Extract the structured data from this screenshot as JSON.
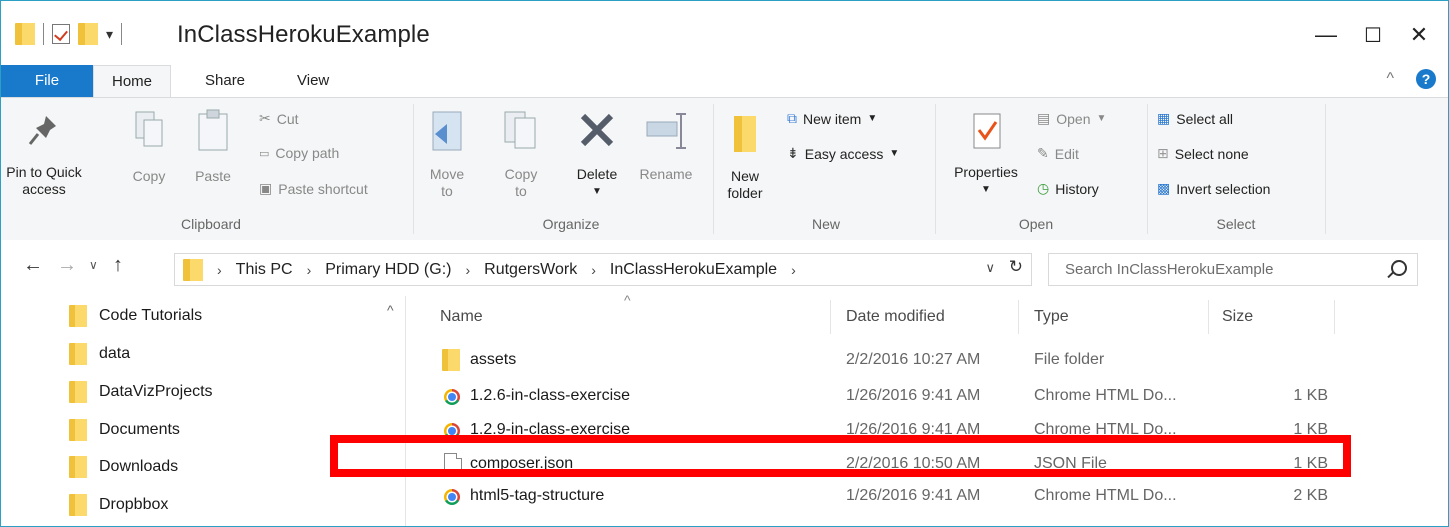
{
  "window": {
    "title": "InClassHerokuExample",
    "controls": {
      "minimize": "—",
      "maximize": "☐",
      "close": "✕"
    }
  },
  "tabs": {
    "file": "File",
    "home": "Home",
    "share": "Share",
    "view": "View"
  },
  "ribbon": {
    "clipboard": {
      "label": "Clipboard",
      "pin": "Pin to Quick access",
      "copy": "Copy",
      "paste": "Paste",
      "cut": "Cut",
      "copy_path": "Copy path",
      "paste_shortcut": "Paste shortcut"
    },
    "organize": {
      "label": "Organize",
      "move_to": "Move to",
      "copy_to": "Copy to",
      "delete": "Delete",
      "rename": "Rename"
    },
    "new": {
      "label": "New",
      "new_folder": "New folder",
      "new_item": "New item",
      "easy_access": "Easy access"
    },
    "open": {
      "label": "Open",
      "properties": "Properties",
      "open": "Open",
      "edit": "Edit",
      "history": "History"
    },
    "select": {
      "label": "Select",
      "select_all": "Select all",
      "select_none": "Select none",
      "invert": "Invert selection"
    }
  },
  "address": {
    "crumbs": [
      "This PC",
      "Primary HDD (G:)",
      "RutgersWork",
      "InClassHerokuExample"
    ],
    "search_placeholder": "Search InClassHerokuExample"
  },
  "nav_pane": {
    "items": [
      "Code Tutorials",
      "data",
      "DataVizProjects",
      "Documents",
      "Downloads",
      "Dropbbox"
    ]
  },
  "columns": {
    "name": "Name",
    "date": "Date modified",
    "type": "Type",
    "size": "Size"
  },
  "files": [
    {
      "name": "assets",
      "date": "2/2/2016 10:27 AM",
      "type": "File folder",
      "size": "",
      "icon": "folder-icon"
    },
    {
      "name": "1.2.6-in-class-exercise",
      "date": "1/26/2016 9:41 AM",
      "type": "Chrome HTML Do...",
      "size": "1 KB",
      "icon": "chrome-icon"
    },
    {
      "name": "1.2.9-in-class-exercise",
      "date": "1/26/2016 9:41 AM",
      "type": "Chrome HTML Do...",
      "size": "1 KB",
      "icon": "chrome-icon"
    },
    {
      "name": "composer.json",
      "date": "2/2/2016 10:50 AM",
      "type": "JSON File",
      "size": "1 KB",
      "icon": "file-icon"
    },
    {
      "name": "html5-tag-structure",
      "date": "1/26/2016 9:41 AM",
      "type": "Chrome HTML Do...",
      "size": "2 KB",
      "icon": "chrome-icon"
    }
  ],
  "colors": {
    "accent": "#1979ca",
    "highlight": "#ff0000",
    "folder": "#f0c23b"
  }
}
